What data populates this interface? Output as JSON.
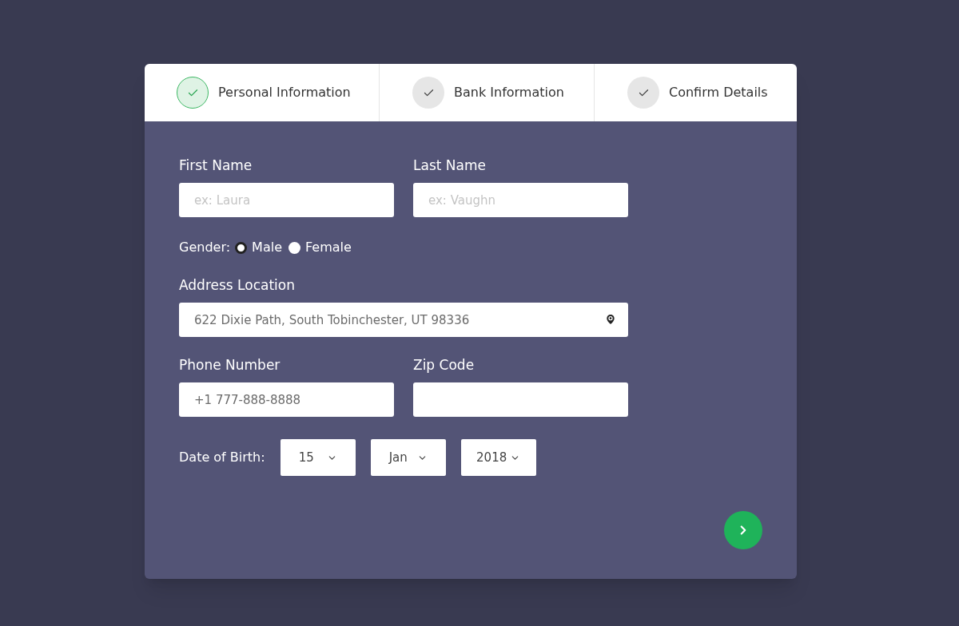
{
  "steps": [
    {
      "label": "Personal Information",
      "selected": true
    },
    {
      "label": "Bank Information",
      "selected": false
    },
    {
      "label": "Confirm Details",
      "selected": false
    }
  ],
  "first_name": {
    "label": "First Name",
    "placeholder": "ex: Laura"
  },
  "last_name": {
    "label": "Last Name",
    "placeholder": "ex: Vaughn"
  },
  "gender": {
    "label": "Gender:",
    "options": [
      {
        "label": "Male",
        "selected": true
      },
      {
        "label": "Female",
        "selected": false
      }
    ]
  },
  "address": {
    "label": "Address Location",
    "value": "622 Dixie Path, South Tobinchester, UT 98336"
  },
  "phone": {
    "label": "Phone Number",
    "value": "+1 777-888-8888"
  },
  "zip": {
    "label": "Zip Code"
  },
  "birth": {
    "label": "Date of Birth:",
    "selects": [
      "15",
      "Jan",
      "2018"
    ]
  }
}
